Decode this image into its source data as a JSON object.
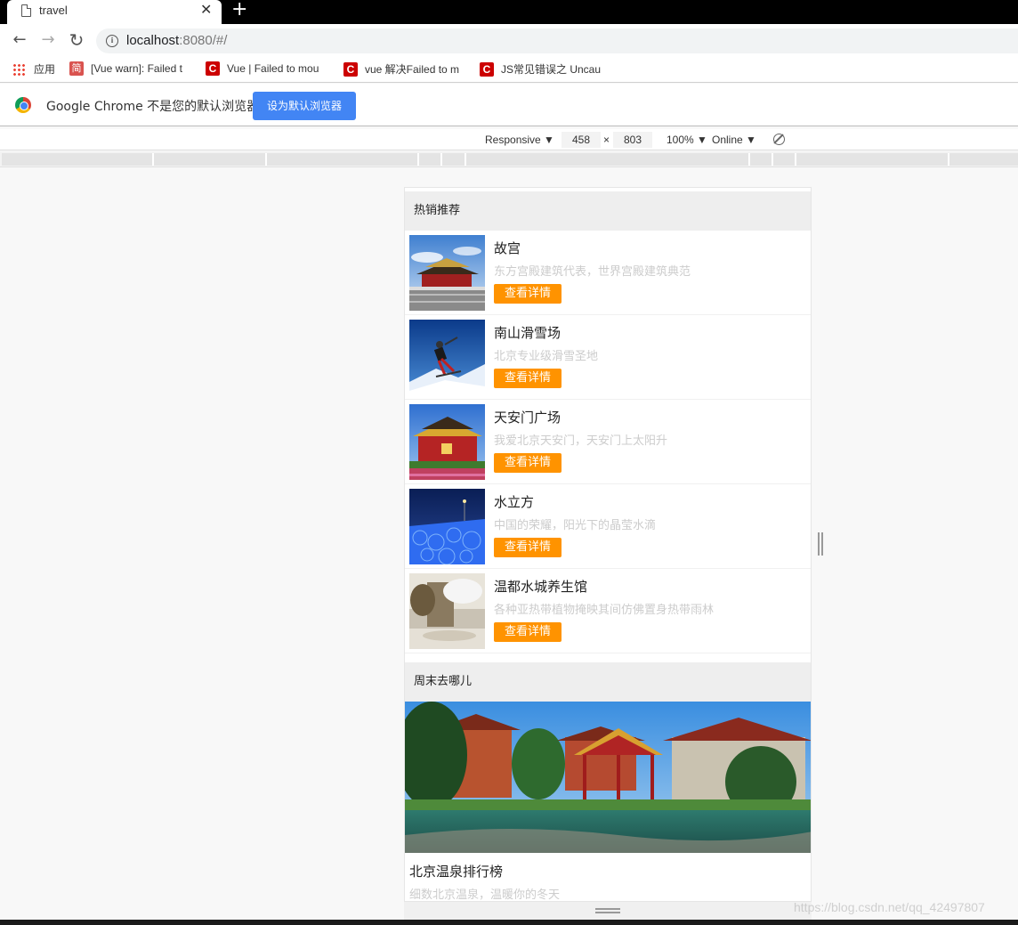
{
  "browser": {
    "tab_title": "travel",
    "tab_close": "✕",
    "new_tab": "+",
    "back": "←",
    "forward": "→",
    "reload": "↻",
    "info": "i",
    "url_host": "localhost",
    "url_rest": ":8080/#/",
    "bookmarks": [
      {
        "label": "应用",
        "icon": "apps-icon"
      },
      {
        "label": "[Vue warn]: Failed t",
        "icon": "jian-icon",
        "icon_text": "简"
      },
      {
        "label": "Vue | Failed to mou",
        "icon": "csdn-icon",
        "icon_text": "C"
      },
      {
        "label": "vue 解决Failed to m",
        "icon": "csdn-icon",
        "icon_text": "C"
      },
      {
        "label": "JS常见错误之 Uncau",
        "icon": "csdn-icon",
        "icon_text": "C"
      }
    ],
    "infobar": {
      "message": "Google Chrome 不是您的默认浏览器",
      "button": "设为默认浏览器"
    },
    "device_toolbar": {
      "mode": "Responsive ▼",
      "width": "458",
      "times": "×",
      "height": "803",
      "zoom": "100% ▼",
      "network": "Online ▼"
    }
  },
  "page": {
    "hot_title": "热销推荐",
    "hot_items": [
      {
        "name": "故宫",
        "desc": "东方宫殿建筑代表，世界宫殿建筑典范",
        "button": "查看详情"
      },
      {
        "name": "南山滑雪场",
        "desc": "北京专业级滑雪圣地",
        "button": "查看详情"
      },
      {
        "name": "天安门广场",
        "desc": "我爱北京天安门，天安门上太阳升",
        "button": "查看详情"
      },
      {
        "name": "水立方",
        "desc": "中国的荣耀，阳光下的晶莹水滴",
        "button": "查看详情"
      },
      {
        "name": "温都水城养生馆",
        "desc": "各种亚热带植物掩映其间仿佛置身热带雨林",
        "button": "查看详情"
      }
    ],
    "weekend_title": "周末去哪儿",
    "weekend_items": [
      {
        "name": "北京温泉排行榜",
        "desc": "细数北京温泉，温暖你的冬天"
      }
    ]
  },
  "watermark": "https://blog.csdn.net/qq_42497807",
  "colors": {
    "accent_orange": "#ff9300",
    "chrome_blue": "#4285f4",
    "section_bg": "#eeeeee",
    "desc_gray": "#cccccc"
  }
}
